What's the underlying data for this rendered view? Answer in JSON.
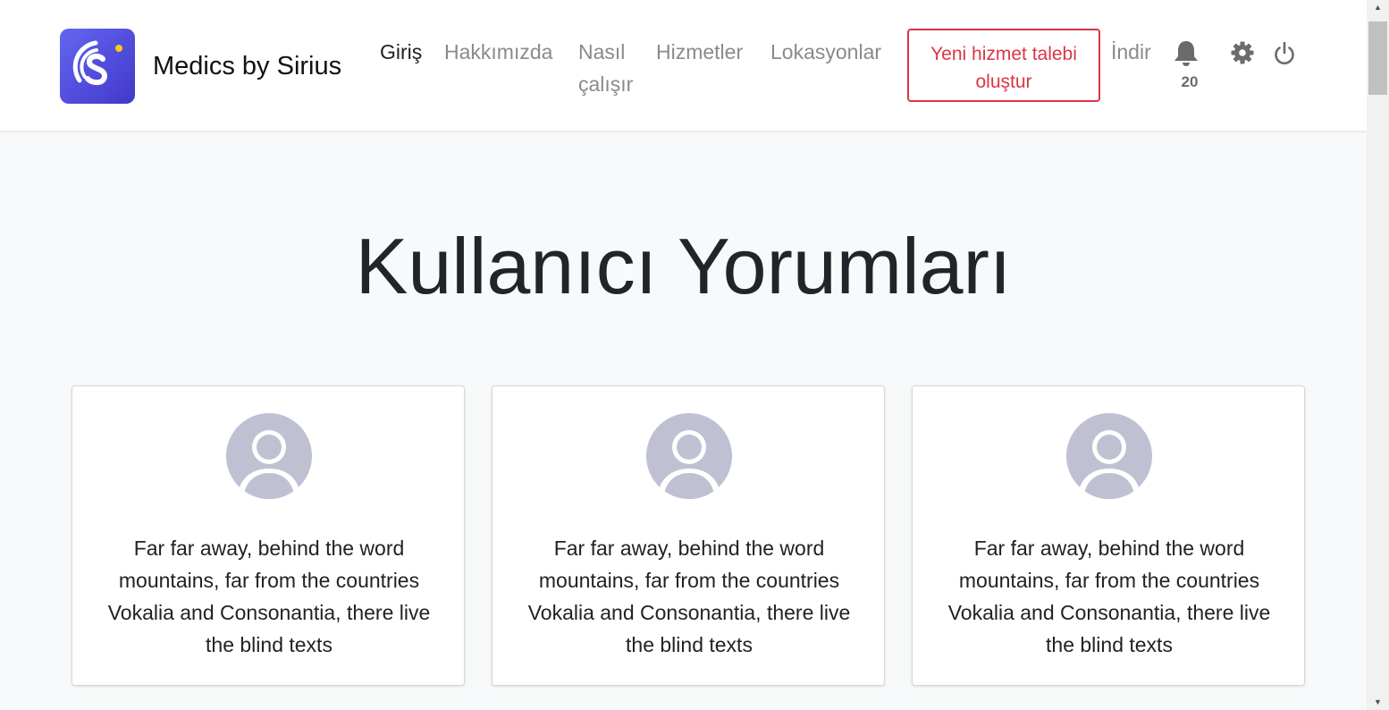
{
  "header": {
    "brand": "Medics by Sirius",
    "nav": [
      {
        "label": "Giriş",
        "active": true
      },
      {
        "label": "Hakkımızda",
        "active": false
      },
      {
        "label": "Nasıl çalışır",
        "active": false
      },
      {
        "label": "Hizmetler",
        "active": false
      },
      {
        "label": "Lokasyonlar",
        "active": false
      }
    ],
    "cta_label": "Yeni hizmet talebi oluştur",
    "download_label": "İndir",
    "notification_count": "20",
    "icons": {
      "logo": "sirius-logo-icon",
      "notifications": "bell-icon",
      "settings": "gear-icon",
      "logout": "power-icon"
    }
  },
  "testimonials": {
    "title": "Kullanıcı Yorumları",
    "items": [
      {
        "text": "Far far away, behind the word mountains, far from the countries Vokalia and Consonantia, there live the blind texts",
        "avatar_icon": "user-avatar-icon"
      },
      {
        "text": "Far far away, behind the word mountains, far from the countries Vokalia and Consonantia, there live the blind texts",
        "avatar_icon": "user-avatar-icon"
      },
      {
        "text": "Far far away, behind the word mountains, far from the countries Vokalia and Consonantia, there live the blind texts",
        "avatar_icon": "user-avatar-icon"
      }
    ]
  },
  "colors": {
    "accent": "#dc3545",
    "brand": "#4f46e5",
    "avatar": "#bfc1d3",
    "background": "#f8f9fa"
  }
}
